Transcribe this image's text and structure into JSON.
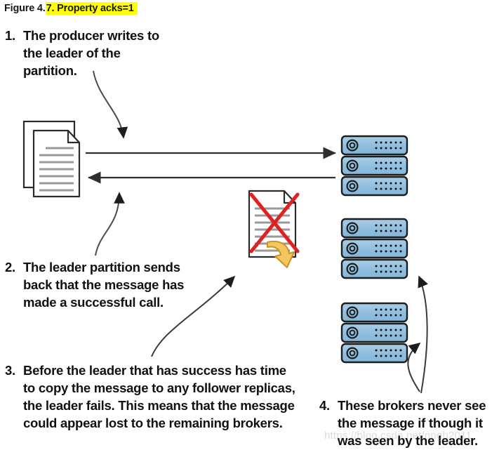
{
  "figure": {
    "caption_prefix": "Figure 4.",
    "caption_highlight": "7. Property acks=1",
    "watermark_text": "https://blog.csdn.net/nngh2011"
  },
  "callouts": [
    {
      "number": "1.",
      "text": "The producer writes to the leader of the partition."
    },
    {
      "number": "2.",
      "text": "The leader partition sends back that the message has made a successful call."
    },
    {
      "number": "3.",
      "text": "Before the leader that has success has time to copy the message to any follower replicas, the leader fails. This means that the message could appear lost to the remaining brokers."
    },
    {
      "number": "4.",
      "text": "These brokers never see the message if though it was seen by the leader."
    }
  ],
  "diagram": {
    "producer_icon": "document-stack-icon",
    "failed_message_icon": "document-crossed-out-icon",
    "brokers": [
      {
        "name": "leader-broker-stack",
        "units": 3
      },
      {
        "name": "follower-broker-stack-1",
        "units": 3
      },
      {
        "name": "follower-broker-stack-2",
        "units": 3
      }
    ],
    "flows": [
      {
        "name": "producer-to-leader-arrow",
        "direction": "right"
      },
      {
        "name": "leader-to-producer-ack-arrow",
        "direction": "left"
      }
    ]
  },
  "colors": {
    "broker_fill": "#8fbede",
    "broker_fill_light": "#a7cce6",
    "broker_stroke": "#1d1d1d",
    "highlight": "#ffff00",
    "cross_red": "#dd2222",
    "arrow_yellow": "#f5c55e",
    "arrow_yellow_stroke": "#c79426",
    "line": "#3a3a3a",
    "doc_line": "#9a9a9a",
    "text": "#111111"
  }
}
